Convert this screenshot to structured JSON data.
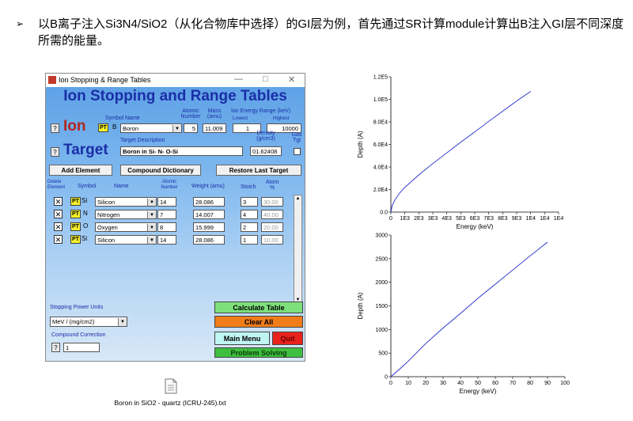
{
  "heading": {
    "bullet": "➢",
    "text": "以B离子注入Si3N4/SiO2（从化合物库中选择）的GI层为例，首先通过SR计算module计算出B注入GI层不同深度所需的能量。"
  },
  "window": {
    "title": "Ion Stopping & Range Tables",
    "controls": {
      "minimize": "—",
      "maximize": "□",
      "close": "✕"
    },
    "app_title": "Ion Stopping and Range Tables",
    "ion": {
      "help": "?",
      "label": "Ion",
      "hdr_symbol": "Symbol",
      "hdr_name": "Name",
      "hdr_atomic": "Atomic Number",
      "hdr_mass": "Mass (amu)",
      "hdr_energy": "Ion Energy Range (keV)",
      "hdr_lowest": "Lowest",
      "hdr_highest": "Highest",
      "pt": "PT",
      "symbol": "B",
      "name": "Boron",
      "atomic_number": "5",
      "mass": "11.009",
      "lowest": "1",
      "highest": "10000"
    },
    "target": {
      "help": "?",
      "label": "Target",
      "hdr_desc": "Target Description",
      "hdr_density": "Density (g/cm3)",
      "hdr_gas": "Gas Tgt",
      "description": "Boron in Si- N- O-Si",
      "density": "01.62408"
    },
    "buttons": {
      "add_element": "Add Element",
      "compound_dictionary": "Compound Dictionary",
      "restore_last_target": "Restore Last Target"
    },
    "table_headers": {
      "delete": "Delete Element",
      "symbol": "Symbol",
      "name": "Name",
      "atomic": "Atomic Number",
      "weight": "Weight (amu)",
      "stoich": "Stoich",
      "atom_pct": "Atom %"
    },
    "elements": [
      {
        "del": "✕",
        "pt": "PT",
        "symbol": "Si",
        "name": "Silicon",
        "atomic": "14",
        "weight": "28.086",
        "stoich": "3",
        "atom_pct": "30.00"
      },
      {
        "del": "✕",
        "pt": "PT",
        "symbol": "N",
        "name": "Nitrogen",
        "atomic": "7",
        "weight": "14.007",
        "stoich": "4",
        "atom_pct": "40.00"
      },
      {
        "del": "✕",
        "pt": "PT",
        "symbol": "O",
        "name": "Oxygen",
        "atomic": "8",
        "weight": "15.999",
        "stoich": "2",
        "atom_pct": "20.00"
      },
      {
        "del": "✕",
        "pt": "PT",
        "symbol": "Si",
        "name": "Silicon",
        "atomic": "14",
        "weight": "28.086",
        "stoich": "1",
        "atom_pct": "10.00"
      }
    ],
    "stopping_units_label": "Stopping Power Units",
    "stopping_units_value": "MeV / (mg/cm2)",
    "compound_correction_label": "Compound Correction",
    "compound_correction_help": "?",
    "compound_correction_value": "1",
    "action_buttons": {
      "calculate": "Calculate Table",
      "clear_all": "Clear All",
      "main_menu": "Main Menu",
      "quit": "Quit",
      "problem_solving": "Problem Solving"
    }
  },
  "file": {
    "name": "Boron in SiO2 - quartz (ICRU-245).txt"
  },
  "colors": {
    "title_blue": "#1b2ea8",
    "ion_red": "#b3261e",
    "pt_yellow": "#f4ef2a",
    "calc_green": "#7ee07a",
    "clear_orange": "#f07d1a",
    "main_menu_cyan": "#bff5f2",
    "quit_red": "#e8231c",
    "problem_green": "#3fbf3f",
    "curve_blue": "#1f2bc8"
  },
  "chart_data": [
    {
      "type": "line",
      "xlabel": "Energy (keV)",
      "ylabel": "Depth (A)",
      "x_ticks": [
        "0",
        "1E3",
        "2E3",
        "3E3",
        "4E3",
        "5E3",
        "6E3",
        "7E3",
        "8E3",
        "9E3",
        "1E4",
        "1E4",
        "1E4"
      ],
      "y_ticks": [
        "0.0",
        "2.0E4",
        "4.0E4",
        "6.0E4",
        "8.0E4",
        "1.0E5",
        "1.2E5"
      ],
      "xlim": [
        0,
        12000
      ],
      "ylim": [
        0,
        120000
      ],
      "x": [
        0,
        100,
        300,
        600,
        1000,
        2000,
        3000,
        4000,
        5000,
        6000,
        7000,
        8000,
        9000,
        10000
      ],
      "y": [
        0,
        6000,
        11000,
        16500,
        22000,
        33000,
        43000,
        52500,
        62000,
        71000,
        80500,
        89500,
        98500,
        107000
      ],
      "grid": false
    },
    {
      "type": "line",
      "xlabel": "Energy (keV)",
      "ylabel": "Depth (A)",
      "x_ticks": [
        "0",
        "10",
        "20",
        "30",
        "40",
        "50",
        "60",
        "70",
        "80",
        "90",
        "100"
      ],
      "y_ticks": [
        "0",
        "500",
        "1000",
        "1500",
        "2000",
        "2500",
        "3000"
      ],
      "xlim": [
        0,
        100
      ],
      "ylim": [
        0,
        3000
      ],
      "x": [
        0,
        5,
        10,
        20,
        30,
        40,
        50,
        60,
        70,
        80,
        90
      ],
      "y": [
        0,
        160,
        330,
        700,
        1030,
        1340,
        1660,
        1960,
        2260,
        2560,
        2850
      ],
      "grid": false
    }
  ]
}
